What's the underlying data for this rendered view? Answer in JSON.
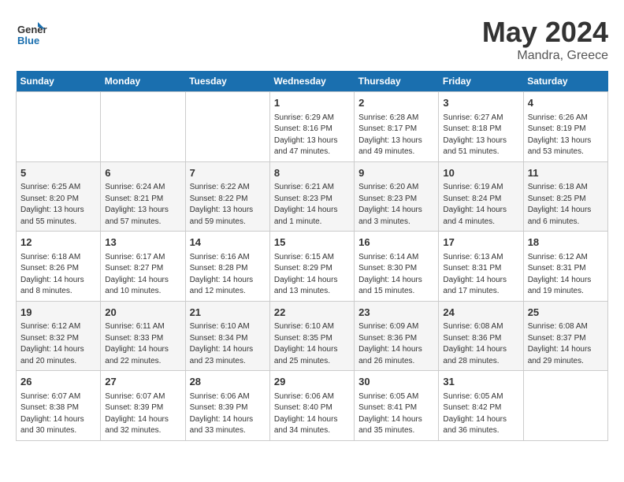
{
  "header": {
    "logo_line1": "General",
    "logo_line2": "Blue",
    "month": "May 2024",
    "location": "Mandra, Greece"
  },
  "weekdays": [
    "Sunday",
    "Monday",
    "Tuesday",
    "Wednesday",
    "Thursday",
    "Friday",
    "Saturday"
  ],
  "weeks": [
    [
      {
        "day": "",
        "info": ""
      },
      {
        "day": "",
        "info": ""
      },
      {
        "day": "",
        "info": ""
      },
      {
        "day": "1",
        "info": "Sunrise: 6:29 AM\nSunset: 8:16 PM\nDaylight: 13 hours\nand 47 minutes."
      },
      {
        "day": "2",
        "info": "Sunrise: 6:28 AM\nSunset: 8:17 PM\nDaylight: 13 hours\nand 49 minutes."
      },
      {
        "day": "3",
        "info": "Sunrise: 6:27 AM\nSunset: 8:18 PM\nDaylight: 13 hours\nand 51 minutes."
      },
      {
        "day": "4",
        "info": "Sunrise: 6:26 AM\nSunset: 8:19 PM\nDaylight: 13 hours\nand 53 minutes."
      }
    ],
    [
      {
        "day": "5",
        "info": "Sunrise: 6:25 AM\nSunset: 8:20 PM\nDaylight: 13 hours\nand 55 minutes."
      },
      {
        "day": "6",
        "info": "Sunrise: 6:24 AM\nSunset: 8:21 PM\nDaylight: 13 hours\nand 57 minutes."
      },
      {
        "day": "7",
        "info": "Sunrise: 6:22 AM\nSunset: 8:22 PM\nDaylight: 13 hours\nand 59 minutes."
      },
      {
        "day": "8",
        "info": "Sunrise: 6:21 AM\nSunset: 8:23 PM\nDaylight: 14 hours\nand 1 minute."
      },
      {
        "day": "9",
        "info": "Sunrise: 6:20 AM\nSunset: 8:23 PM\nDaylight: 14 hours\nand 3 minutes."
      },
      {
        "day": "10",
        "info": "Sunrise: 6:19 AM\nSunset: 8:24 PM\nDaylight: 14 hours\nand 4 minutes."
      },
      {
        "day": "11",
        "info": "Sunrise: 6:18 AM\nSunset: 8:25 PM\nDaylight: 14 hours\nand 6 minutes."
      }
    ],
    [
      {
        "day": "12",
        "info": "Sunrise: 6:18 AM\nSunset: 8:26 PM\nDaylight: 14 hours\nand 8 minutes."
      },
      {
        "day": "13",
        "info": "Sunrise: 6:17 AM\nSunset: 8:27 PM\nDaylight: 14 hours\nand 10 minutes."
      },
      {
        "day": "14",
        "info": "Sunrise: 6:16 AM\nSunset: 8:28 PM\nDaylight: 14 hours\nand 12 minutes."
      },
      {
        "day": "15",
        "info": "Sunrise: 6:15 AM\nSunset: 8:29 PM\nDaylight: 14 hours\nand 13 minutes."
      },
      {
        "day": "16",
        "info": "Sunrise: 6:14 AM\nSunset: 8:30 PM\nDaylight: 14 hours\nand 15 minutes."
      },
      {
        "day": "17",
        "info": "Sunrise: 6:13 AM\nSunset: 8:31 PM\nDaylight: 14 hours\nand 17 minutes."
      },
      {
        "day": "18",
        "info": "Sunrise: 6:12 AM\nSunset: 8:31 PM\nDaylight: 14 hours\nand 19 minutes."
      }
    ],
    [
      {
        "day": "19",
        "info": "Sunrise: 6:12 AM\nSunset: 8:32 PM\nDaylight: 14 hours\nand 20 minutes."
      },
      {
        "day": "20",
        "info": "Sunrise: 6:11 AM\nSunset: 8:33 PM\nDaylight: 14 hours\nand 22 minutes."
      },
      {
        "day": "21",
        "info": "Sunrise: 6:10 AM\nSunset: 8:34 PM\nDaylight: 14 hours\nand 23 minutes."
      },
      {
        "day": "22",
        "info": "Sunrise: 6:10 AM\nSunset: 8:35 PM\nDaylight: 14 hours\nand 25 minutes."
      },
      {
        "day": "23",
        "info": "Sunrise: 6:09 AM\nSunset: 8:36 PM\nDaylight: 14 hours\nand 26 minutes."
      },
      {
        "day": "24",
        "info": "Sunrise: 6:08 AM\nSunset: 8:36 PM\nDaylight: 14 hours\nand 28 minutes."
      },
      {
        "day": "25",
        "info": "Sunrise: 6:08 AM\nSunset: 8:37 PM\nDaylight: 14 hours\nand 29 minutes."
      }
    ],
    [
      {
        "day": "26",
        "info": "Sunrise: 6:07 AM\nSunset: 8:38 PM\nDaylight: 14 hours\nand 30 minutes."
      },
      {
        "day": "27",
        "info": "Sunrise: 6:07 AM\nSunset: 8:39 PM\nDaylight: 14 hours\nand 32 minutes."
      },
      {
        "day": "28",
        "info": "Sunrise: 6:06 AM\nSunset: 8:39 PM\nDaylight: 14 hours\nand 33 minutes."
      },
      {
        "day": "29",
        "info": "Sunrise: 6:06 AM\nSunset: 8:40 PM\nDaylight: 14 hours\nand 34 minutes."
      },
      {
        "day": "30",
        "info": "Sunrise: 6:05 AM\nSunset: 8:41 PM\nDaylight: 14 hours\nand 35 minutes."
      },
      {
        "day": "31",
        "info": "Sunrise: 6:05 AM\nSunset: 8:42 PM\nDaylight: 14 hours\nand 36 minutes."
      },
      {
        "day": "",
        "info": ""
      }
    ]
  ]
}
